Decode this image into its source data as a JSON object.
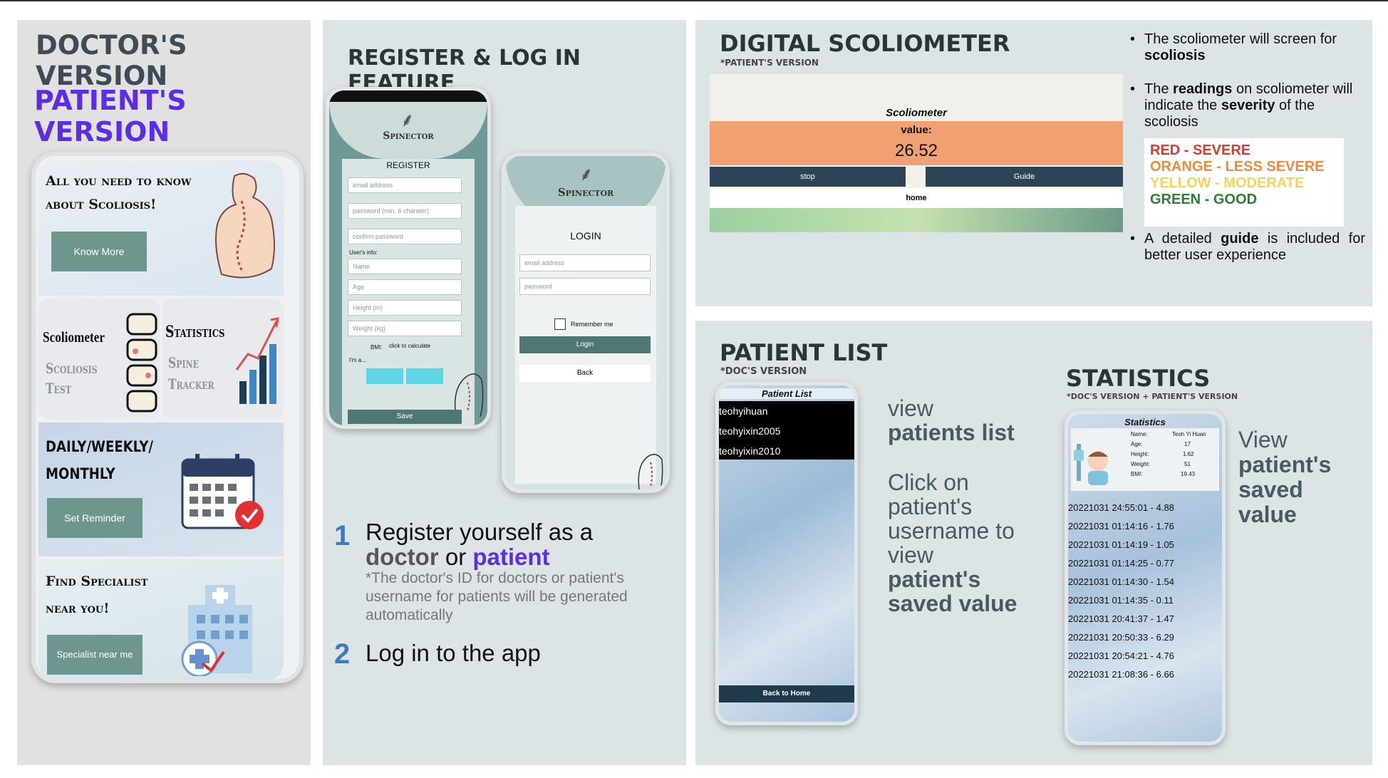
{
  "doctor_panel": {
    "doctor_title": "DOCTOR'S VERSION",
    "patient_title": "PATIENT'S VERSION",
    "card1_title_line1": "All you need to know",
    "card1_title_line2": "about Scoliosis!",
    "card1_button": "Know More",
    "card2_title": "Scoliometer",
    "card2_sub1": "Scoliosis",
    "card2_sub2": "Test",
    "card3_title": "Statistics",
    "card3_sub1": "Spine",
    "card3_sub2": "Tracker",
    "card4_title_line1": "DAILY/WEEKLY/",
    "card4_title_line2": "MONTHLY",
    "card4_button": "Set Reminder",
    "card5_title_line1": "Find Specialist",
    "card5_title_line2": "near you!",
    "card5_button": "Specialist near me"
  },
  "register_panel": {
    "title": "REGISTER & LOG IN FEATURE",
    "reg_brand": "Spinector",
    "reg_heading": "REGISTER",
    "reg_email": "email address",
    "reg_password": "password (min. 6 charater)",
    "reg_confirm": "confirm password",
    "reg_userinfo": "User's info:",
    "reg_name": "Name",
    "reg_age": "Age",
    "reg_height": "Height (m)",
    "reg_weight": "Weight (kg)",
    "reg_bmi_label": "BMI:",
    "reg_bmi_value": "click to calculate",
    "reg_im": "I'm a...",
    "reg_save": "Save",
    "login_brand": "Spinector",
    "login_heading": "LOGIN",
    "login_email": "email address",
    "login_password": "password",
    "login_remember": "Remember me",
    "login_button": "Login",
    "login_back": "Back",
    "step1_num": "1",
    "step1_line1": "Register yourself as a",
    "step1_doctor": "doctor",
    "step1_or": " or ",
    "step1_patient": "patient",
    "step1_note": "*The doctor's ID for doctors or patient's username for patients will be generated automatically",
    "step2_num": "2",
    "step2_text": "Log in to the app"
  },
  "scoliometer_panel": {
    "title": "DIGITAL SCOLIOMETER",
    "subtitle": "*PATIENT'S VERSION",
    "screen_title": "Scoliometer",
    "value_label": "value:",
    "value": "26.52",
    "stop_button": "stop",
    "guide_button": "Guide",
    "home_button": "home",
    "bullet1_a": "The scoliometer will screen for ",
    "bullet1_b": "scoliosis",
    "bullet2_a": "The ",
    "bullet2_b": "readings",
    "bullet2_c": " on scoliometer will indicate the ",
    "bullet2_d": "severity",
    "bullet2_e": " of the scoliosis",
    "legend": [
      {
        "text": "RED - SEVERE",
        "color": "#e03a2f"
      },
      {
        "text": "ORANGE - LESS SEVERE",
        "color": "#f08a3c"
      },
      {
        "text": "YELLOW - MODERATE",
        "color": "#f2d45a"
      },
      {
        "text": "GREEN - GOOD",
        "color": "#2e7d32"
      }
    ],
    "bullet3_a": "A detailed ",
    "bullet3_b": "guide",
    "bullet3_c": " is included for better user experience"
  },
  "patient_list_panel": {
    "title": "PATIENT LIST",
    "subtitle": "*DOC'S VERSION",
    "screen_title": "Patient List",
    "patients": [
      "teohyihuan",
      "teohyixin2005",
      "teohyixin2010"
    ],
    "back_button": "Back to Home",
    "desc1_a": "view",
    "desc1_b": "patients list",
    "desc2_a": "Click on patient's username to view",
    "desc2_b": "patient's saved value"
  },
  "statistics_panel": {
    "title": "STATISTICS",
    "subtitle": "*DOC'S VERSION + PATIENT'S VERSION",
    "screen_title": "Statistics",
    "info": [
      {
        "label": "Name:",
        "value": "Teoh Yi Huan"
      },
      {
        "label": "Age:",
        "value": "17"
      },
      {
        "label": "Height:",
        "value": "1.62"
      },
      {
        "label": "Weight:",
        "value": "51"
      },
      {
        "label": "BMI:",
        "value": "19.43"
      }
    ],
    "records": [
      "20221031 24:55:01 -  4.88",
      "20221031 01:14:16 -  1.76",
      "20221031 01:14:19 -  1.05",
      "20221031 01:14:25 -  0.77",
      "20221031 01:14:30 -  1.54",
      "20221031 01:14:35 -  0.11",
      "20221031 20:41:37 -  1.47",
      "20221031 20:50:33 -  6.29",
      "20221031 20:54:21 -  4.76",
      "20221031 21:08:36 -  6.66"
    ],
    "desc_a": "View",
    "desc_b": "patient's saved value"
  },
  "colors": {
    "panel_grey": "#e1e1e1",
    "panel_blue": "#dce4e6",
    "purple": "#5b2ee6",
    "dark_slate": "#3d4a52",
    "teal_btn": "#6e968f",
    "step_num": "#3b7bbf"
  }
}
